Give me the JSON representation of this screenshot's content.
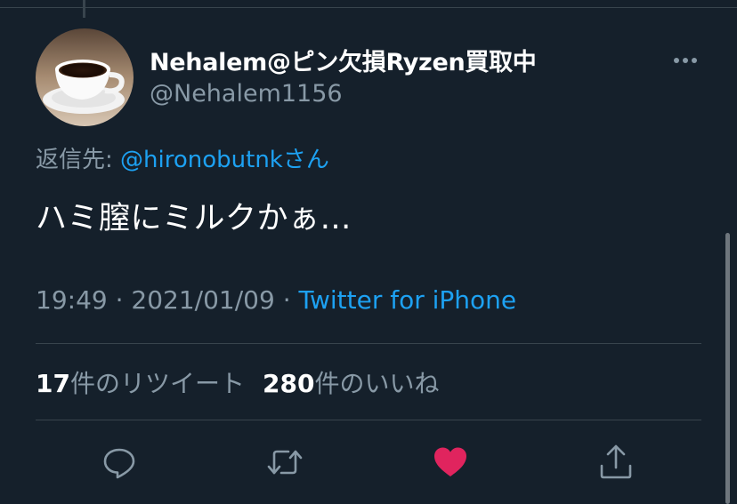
{
  "tweet": {
    "display_name": "Nehalem@ピン欠損Ryzen買取中",
    "handle": "@Nehalem1156",
    "reply_prefix": "返信先: ",
    "reply_mention": "@hironobutnkさん",
    "text": "ハミ膣にミルクかぁ…",
    "time": "19:49",
    "sep": " · ",
    "date": "2021/01/09",
    "source": "Twitter for iPhone"
  },
  "stats": {
    "retweet_count": "17",
    "retweet_label": "件のリツイート",
    "like_count": "280",
    "like_label": "件のいいね"
  },
  "icons": {
    "avatar": "coffee-cup-avatar",
    "more": "more-icon",
    "reply": "reply-icon",
    "retweet": "retweet-icon",
    "like": "heart-icon",
    "share": "share-icon"
  },
  "colors": {
    "background": "#15202b",
    "accent": "#1da1f2",
    "muted": "#8899a6",
    "like": "#e0245e"
  }
}
